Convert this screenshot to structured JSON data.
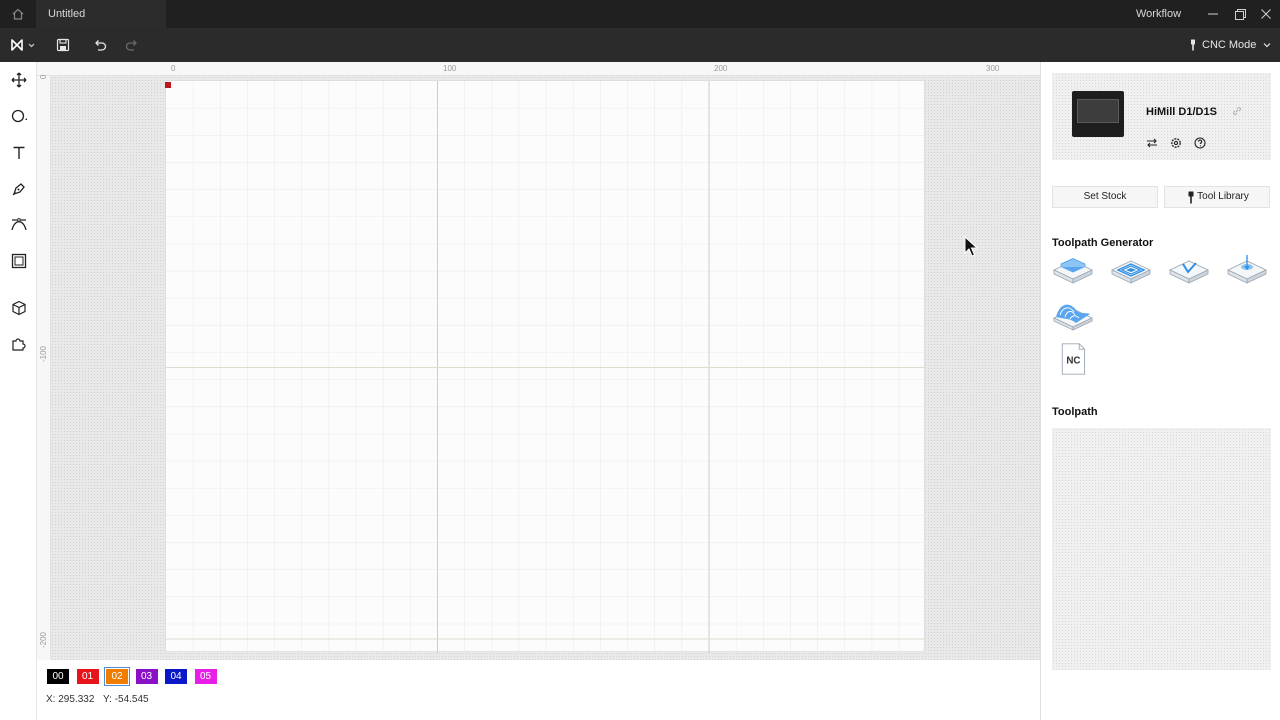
{
  "titlebar": {
    "doc_tab": "Untitled",
    "workflow": "Workflow"
  },
  "toolbar": {
    "mode_label": "CNC Mode"
  },
  "ruler": {
    "top": [
      "0",
      "100",
      "200",
      "300"
    ],
    "left": [
      "0",
      "-100",
      "-200"
    ]
  },
  "layers": [
    {
      "label": "00",
      "color": "#000000"
    },
    {
      "label": "01",
      "color": "#e8141c"
    },
    {
      "label": "02",
      "color": "#f07d00"
    },
    {
      "label": "03",
      "color": "#8a10c8"
    },
    {
      "label": "04",
      "color": "#0a18c8"
    },
    {
      "label": "05",
      "color": "#e81ee8"
    }
  ],
  "coords": {
    "x": "X: 295.332",
    "y": "Y: -54.545"
  },
  "device": {
    "name": "HiMill D1/D1S"
  },
  "buttons": {
    "set_stock": "Set Stock",
    "tool_library": "Tool Library"
  },
  "sections": {
    "toolpath_generator": "Toolpath Generator",
    "toolpath": "Toolpath"
  },
  "toolpath_generator": {
    "nc_label": "NC"
  },
  "colors": {
    "accent": "#2d8fe8",
    "titlebar": "#202020",
    "toolbar": "#2b2b2b",
    "origin": "#c0161b"
  },
  "icons": [
    "home-icon",
    "logo-icon",
    "save-icon",
    "undo-icon",
    "redo-icon",
    "minimize-icon",
    "maximize-icon",
    "close-icon",
    "move-icon",
    "ellipse-icon",
    "text-icon",
    "pen-icon",
    "curve-icon",
    "frame-icon",
    "cube-icon",
    "puzzle-icon",
    "swap-icon",
    "settings-icon",
    "help-icon",
    "link-icon",
    "end-mill-icon"
  ]
}
